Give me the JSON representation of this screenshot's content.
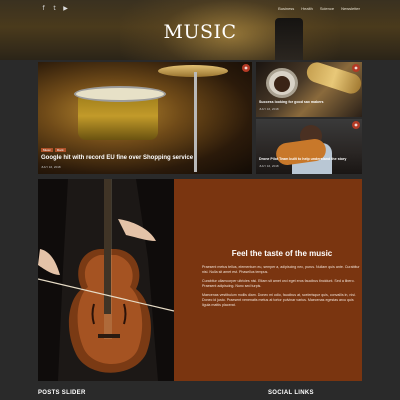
{
  "header": {
    "social_icons": [
      "facebook-icon",
      "twitter-icon",
      "youtube-icon"
    ],
    "social_glyphs": [
      "f",
      "t",
      "▶"
    ],
    "nav": [
      "Business",
      "Health",
      "Science",
      "Newsletter"
    ],
    "logo": "MUSIC"
  },
  "featured": [
    {
      "tags": [
        "Music",
        "Rock"
      ],
      "title": "Google hit with record EU fine over Shopping service",
      "date": "JULY 16, 2018"
    },
    {
      "title": "Success looking for good sax makers",
      "date": "JULY 16, 2018"
    },
    {
      "title": "Drone Pilot Team built to help understand the story",
      "date": "JULY 16, 2018"
    }
  ],
  "promo": {
    "title": "Feel the taste of the music",
    "paragraphs": [
      "Praesent metus tellus, elementum eu, semper a, adipiscing nec, purus. Nullam quis ante. Curabitur nisi. Nulla sit amet est. Phasellus tempus.",
      "Curabitur ullamcorper ultricies nisi. Etiam sit amet orci eget eros faucibus tincidunt. Sed a libero. Praesent adipiscing. Nunc sed turpis.",
      "Maecenas vestibulum mollis diam. Donec mi odio, faucibus at, scelerisque quis, convallis in, nisi. Donec id justo. Praesent venenatis metus at tortor pulvinar varius. Maecenas egestas arcu quis ligula mattis placerat."
    ]
  },
  "footer": {
    "posts_slider": "POSTS SLIDER",
    "social_links": "SOCIAL LINKS"
  },
  "colors": {
    "accent": "#ad5028",
    "promo_bg": "#7a3510",
    "page_bg": "#2a2a2a"
  }
}
